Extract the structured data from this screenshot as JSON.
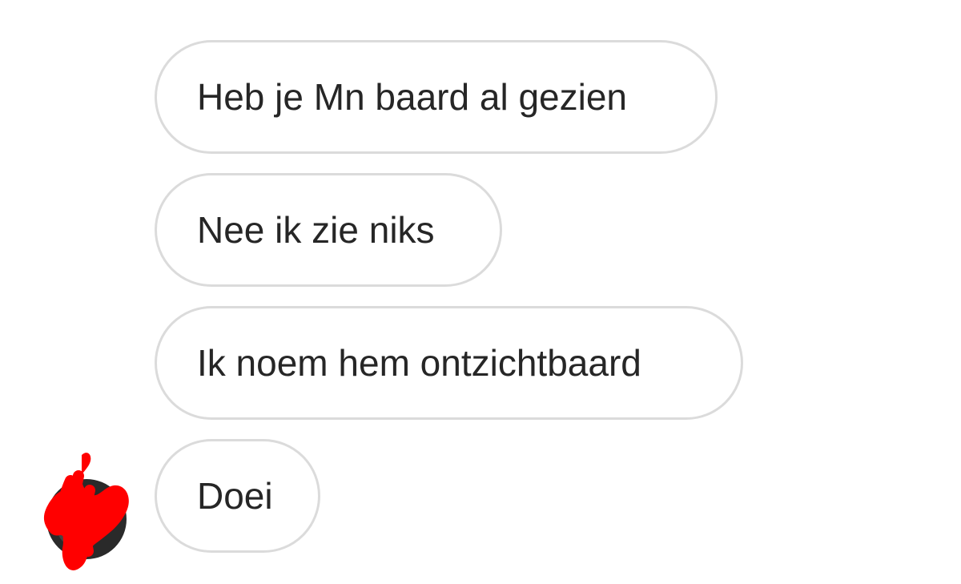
{
  "conversation": {
    "messages": [
      {
        "text": "Heb je Mn baard al gezien"
      },
      {
        "text": "Nee ik zie niks"
      },
      {
        "text": "Ik noem hem ontzichtbaard"
      },
      {
        "text": "Doei"
      }
    ]
  },
  "colors": {
    "bubble_border": "#dbdbdb",
    "text": "#262626",
    "background": "#ffffff",
    "redaction": "#ff0000"
  },
  "icons": {
    "avatar": "profile-avatar (redacted with red scribble)"
  }
}
